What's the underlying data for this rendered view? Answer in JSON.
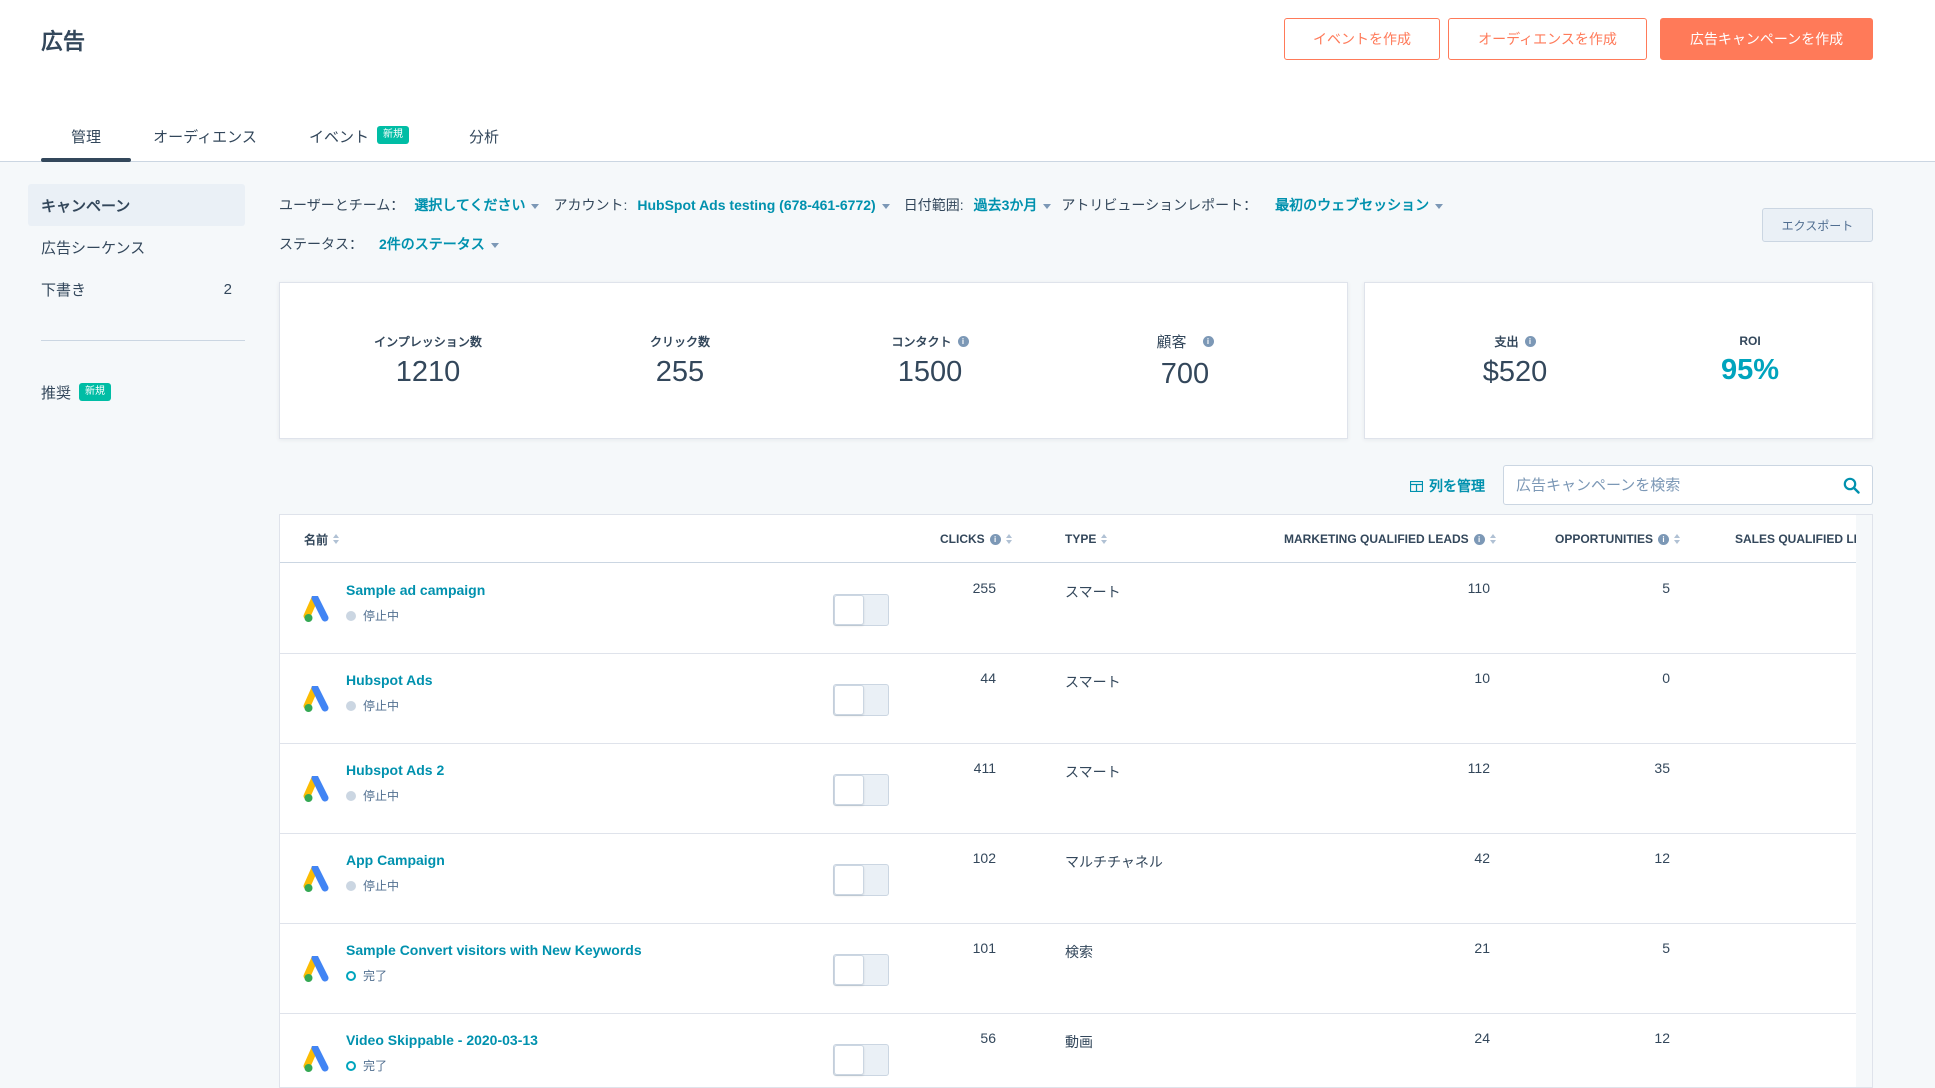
{
  "header": {
    "title": "広告",
    "buttons": {
      "create_event": "イベントを作成",
      "create_audience": "オーディエンスを作成",
      "create_campaign": "広告キャンペーンを作成"
    }
  },
  "tabs": [
    {
      "label": "管理"
    },
    {
      "label": "オーディエンス"
    },
    {
      "label": "イベント",
      "badge": "新規"
    },
    {
      "label": "分析"
    }
  ],
  "sidebar": {
    "campaigns": "キャンペーン",
    "sequences": "広告シーケンス",
    "drafts": "下書き",
    "drafts_count": "2",
    "recommended": "推奨",
    "recommended_badge": "新規"
  },
  "filters": {
    "users_teams_label": "ユーザーとチーム：",
    "users_teams_value": "選択してください",
    "account_label": "アカウント:",
    "account_value": "HubSpot Ads testing (678-461-6772)",
    "date_range_label": "日付範囲:",
    "date_range_value": "過去3か月",
    "attribution_label": "アトリビューションレポート：",
    "attribution_value": "最初のウェブセッション",
    "status_label": "ステータス：",
    "status_value": "2件のステータス",
    "export": "エクスポート"
  },
  "metrics": {
    "impressions_label": "インプレッション数",
    "impressions": "1210",
    "clicks_label": "クリック数",
    "clicks": "255",
    "contacts_label": "コンタクト",
    "contacts": "1500",
    "customers_label": "顧客",
    "customers": "700",
    "spend_label": "支出",
    "spend": "$520",
    "roi_label": "ROI",
    "roi": "95%"
  },
  "table_tools": {
    "manage_columns": "列を管理",
    "search_placeholder": "広告キャンペーンを検索"
  },
  "table": {
    "columns": {
      "name": "名前",
      "clicks": "CLICKS",
      "type": "TYPE",
      "mql": "MARKETING QUALIFIED LEADS",
      "opportunities": "OPPORTUNITIES",
      "sql": "SALES QUALIFIED LEA"
    },
    "rows": [
      {
        "name": "Sample ad campaign",
        "status": "停止中",
        "clicks": "255",
        "type": "スマート",
        "mql": "110",
        "opportunities": "5"
      },
      {
        "name": "Hubspot Ads",
        "status": "停止中",
        "clicks": "44",
        "type": "スマート",
        "mql": "10",
        "opportunities": "0"
      },
      {
        "name": "Hubspot Ads 2",
        "status": "停止中",
        "clicks": "411",
        "type": "スマート",
        "mql": "112",
        "opportunities": "35"
      },
      {
        "name": "App Campaign",
        "status": "停止中",
        "clicks": "102",
        "type": "マルチチャネル",
        "mql": "42",
        "opportunities": "12"
      },
      {
        "name": "Sample Convert visitors with New Keywords",
        "status": "完了",
        "clicks": "101",
        "type": "検索",
        "mql": "21",
        "opportunities": "5"
      },
      {
        "name": "Video Skippable - 2020-03-13",
        "status": "完了",
        "clicks": "56",
        "type": "動画",
        "mql": "24",
        "opportunities": "12"
      }
    ]
  },
  "colors": {
    "accent_orange": "#ff7a59",
    "link_teal": "#0091ae",
    "roi_teal": "#00a4bd",
    "badge_green": "#00bda5"
  }
}
